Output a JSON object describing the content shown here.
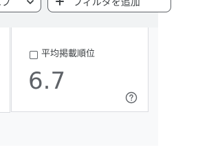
{
  "toolbar": {
    "left_chip_label": "エブ",
    "add_filter_label": "フィルタを追加"
  },
  "metric": {
    "label": "平均掲載順位",
    "value": "6.7",
    "checked": false
  },
  "colors": {
    "card_background": "#ffffff",
    "panel_background": "#f8f9fa",
    "text_primary": "#3c4043",
    "value_text": "#5f6368",
    "border": "#dadce0"
  },
  "icons": {
    "caret": "chevron-down-icon",
    "add": "plus-icon",
    "help": "help-circle-icon"
  }
}
